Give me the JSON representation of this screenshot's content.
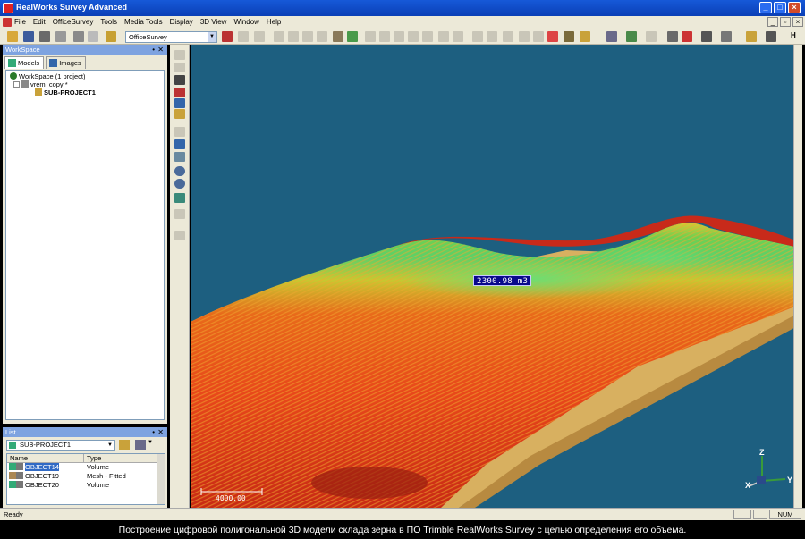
{
  "window": {
    "title": "RealWorks Survey Advanced"
  },
  "menu": {
    "items": [
      "File",
      "Edit",
      "OfficeSurvey",
      "Tools",
      "Media Tools",
      "Display",
      "3D View",
      "Window",
      "Help"
    ]
  },
  "toolbar": {
    "mode_combo": "OfficeSurvey"
  },
  "workspace": {
    "title": "WorkSpace",
    "tabs": [
      "Models",
      "Images"
    ],
    "tree": {
      "root": "WorkSpace (1 project)",
      "project": "vrem_copy  *",
      "subproject": "SUB-PROJECT1"
    }
  },
  "list": {
    "title": "List",
    "combo_value": "SUB-PROJECT1",
    "columns": [
      "Name",
      "Type"
    ],
    "rows": [
      {
        "name": "OBJECT14",
        "type": "Volume",
        "selected": true
      },
      {
        "name": "OBJECT19",
        "type": "Mesh - Fitted",
        "selected": false
      },
      {
        "name": "OBJECT20",
        "type": "Volume",
        "selected": false
      }
    ]
  },
  "viewport": {
    "volume_label": "2300.98  m3",
    "scale_label": "4000.00",
    "axes": {
      "x": "X",
      "y": "Y",
      "z": "Z"
    },
    "background": "#1d5f80"
  },
  "status": {
    "text": "Ready",
    "num": "NUM"
  },
  "caption": "Построение цифровой полигональной 3D модели склада зерна в ПО Trimble RealWorks Survey с целью определения его объема."
}
